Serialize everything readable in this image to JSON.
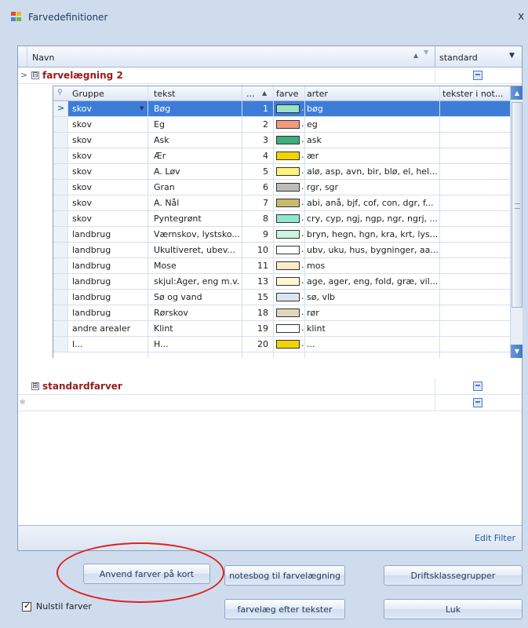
{
  "window": {
    "title": "Farvedefinitioner",
    "close_glyph": "x"
  },
  "outer_grid": {
    "columns": {
      "navn": "Navn",
      "standard": "standard"
    },
    "groups": [
      {
        "expander": ">",
        "toggle": "⊟",
        "name": "farvelægning 2"
      },
      {
        "toggle": "⊞",
        "name": "standardfarver"
      }
    ],
    "new_row_glyph": "✻"
  },
  "detail_grid": {
    "columns": {
      "gruppe": "Gruppe",
      "tekst": "tekst",
      "nr": "...",
      "nr_sort": "▲",
      "farve": "farve",
      "arter": "arter",
      "tekster": "tekster i not..."
    },
    "rows": [
      {
        "gruppe": "skov",
        "tekst": "Bøg",
        "nr": "1",
        "color": "#9fe3c5",
        "arter": "bøg"
      },
      {
        "gruppe": "skov",
        "tekst": "Eg",
        "nr": "2",
        "color": "#f29b7a",
        "arter": "eg"
      },
      {
        "gruppe": "skov",
        "tekst": "Ask",
        "nr": "3",
        "color": "#3dae7c",
        "arter": "ask"
      },
      {
        "gruppe": "skov",
        "tekst": "Ær",
        "nr": "4",
        "color": "#f4d400",
        "arter": "ær"
      },
      {
        "gruppe": "skov",
        "tekst": "A. Løv",
        "nr": "5",
        "color": "#fff27a",
        "arter": "alø, asp, avn, bir, blø, el, hel..."
      },
      {
        "gruppe": "skov",
        "tekst": "Gran",
        "nr": "6",
        "color": "#bcbcbc",
        "arter": "rgr, sgr"
      },
      {
        "gruppe": "skov",
        "tekst": "A. Nål",
        "nr": "7",
        "color": "#c9b96a",
        "arter": "abi, anå, bjf, cof, con, dgr, f..."
      },
      {
        "gruppe": "skov",
        "tekst": "Pyntegrønt",
        "nr": "8",
        "color": "#8fe8cd",
        "arter": "cry, cyp, ngj, ngp, ngr, ngrj, ..."
      },
      {
        "gruppe": "landbrug",
        "tekst": "Værnskov, lystsko...",
        "nr": "9",
        "color": "#c8f4e0",
        "arter": "bryn, hegn, hgn, kra, krt, lys..."
      },
      {
        "gruppe": "landbrug",
        "tekst": "Ukultiveret, ubev...",
        "nr": "10",
        "color": "#ffffff",
        "arter": "ubv, uku, hus, bygninger, aa..."
      },
      {
        "gruppe": "landbrug",
        "tekst": "Mose",
        "nr": "11",
        "color": "#fdebc8",
        "arter": "mos"
      },
      {
        "gruppe": "landbrug",
        "tekst": "skjul:Ager, eng m.v.",
        "nr": "13",
        "color": "#fff7d2",
        "arter": "age, ager, eng, fold, græ, vil..."
      },
      {
        "gruppe": "landbrug",
        "tekst": "Sø og vand",
        "nr": "15",
        "color": "#dbe4f4",
        "arter": "sø, vlb"
      },
      {
        "gruppe": "landbrug",
        "tekst": "Rørskov",
        "nr": "18",
        "color": "#e0d6bb",
        "arter": "rør"
      },
      {
        "gruppe": "andre arealer",
        "tekst": "Klint",
        "nr": "19",
        "color": "#ffffff",
        "arter": "klint"
      },
      {
        "gruppe": "l...",
        "tekst": "H...",
        "nr": "20",
        "color": "#f4d400",
        "arter": "..."
      }
    ],
    "selected_row": 0,
    "row_marker": ">",
    "edit_filter": "Edit Filter"
  },
  "buttons": {
    "anvend": "Anvend farver på kort",
    "notesbog": "notesbog til farvelægning",
    "driftsklasse": "Driftsklassegrupper",
    "farvelaeg": "farvelæg efter tekster",
    "luk": "Luk"
  },
  "checkbox": {
    "label": "Nulstil farver",
    "checked": true,
    "mark": "✓"
  },
  "icons": [
    "app-icon",
    "close-icon",
    "expand-icon",
    "sort-asc-icon",
    "filter-icon",
    "dropdown-icon",
    "check-icon"
  ]
}
